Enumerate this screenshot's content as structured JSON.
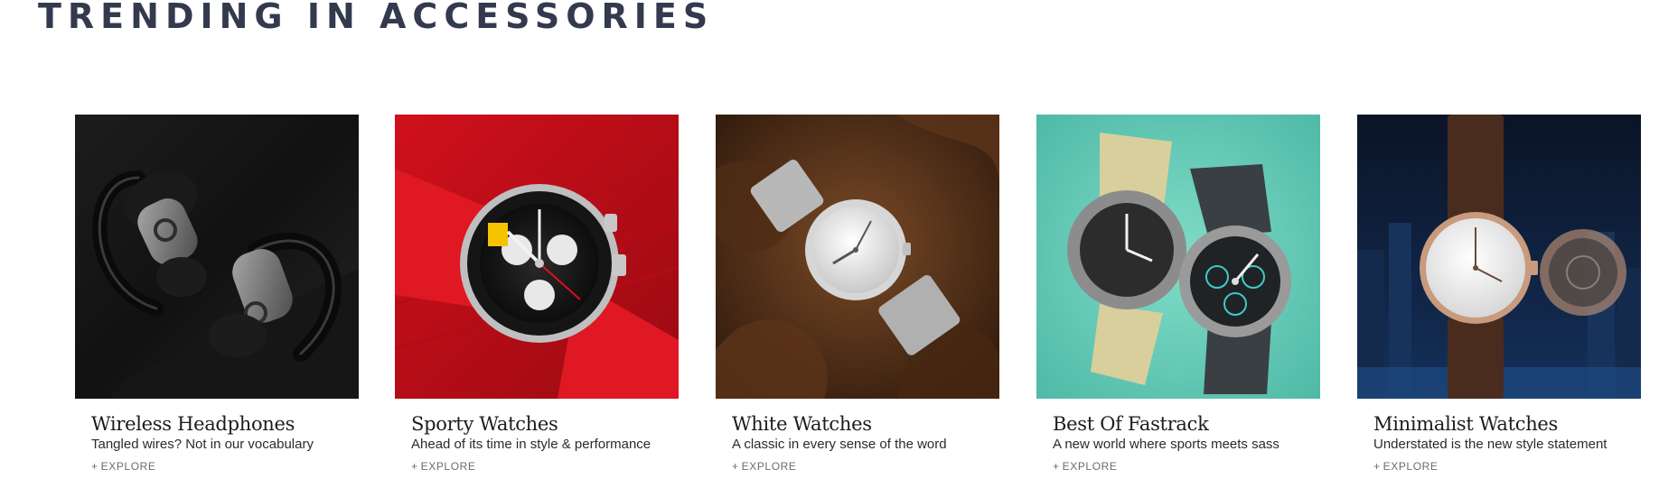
{
  "section": {
    "title": "TRENDING IN ACCESSORIES"
  },
  "explore_prefix": "+",
  "cards": [
    {
      "title": "Wireless Headphones",
      "description": "Tangled wires? Not in our vocabulary",
      "explore_label": "EXPLORE",
      "image": "wireless-earbuds-image"
    },
    {
      "title": "Sporty Watches",
      "description": "Ahead of its time in style & performance",
      "explore_label": "EXPLORE",
      "image": "red-chronograph-watch-image"
    },
    {
      "title": "White Watches",
      "description": "A classic in every sense of the word",
      "explore_label": "EXPLORE",
      "image": "white-dial-watch-on-leaves-image"
    },
    {
      "title": "Best Of Fastrack",
      "description": "A new world where sports meets sass",
      "explore_label": "EXPLORE",
      "image": "fastrack-watches-teal-image"
    },
    {
      "title": "Minimalist Watches",
      "description": "Understated is the new style statement",
      "explore_label": "EXPLORE",
      "image": "minimalist-leather-watch-image"
    }
  ]
}
